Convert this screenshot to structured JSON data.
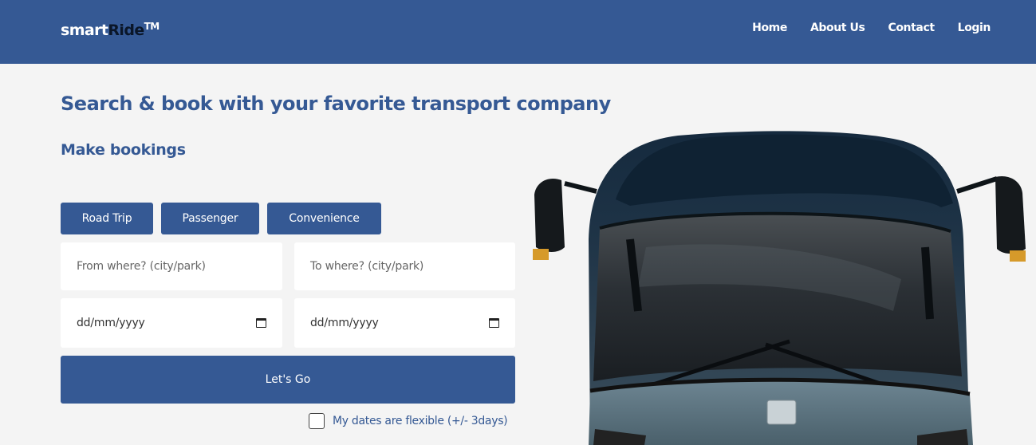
{
  "brand": {
    "part1": "smart",
    "part2": "Ride",
    "tm": "TM"
  },
  "nav": [
    "Home",
    "About Us",
    "Contact",
    "Login"
  ],
  "headline": "Search & book with your favorite transport company",
  "subhead": "Make bookings",
  "tabs": [
    "Road Trip",
    "Passenger",
    "Convenience"
  ],
  "form": {
    "from_placeholder": "From where? (city/park)",
    "to_placeholder": "To where? (city/park)",
    "date1_placeholder": "dd/mm/yyyy",
    "date2_placeholder": "dd/mm/yyyy",
    "submit_label": "Let's Go",
    "flexible_label": "My dates are flexible (+/- 3days)",
    "flexible_checked": false
  },
  "colors": {
    "primary": "#355994",
    "background": "#f4f4f4",
    "brand_dark": "#0a1628"
  },
  "hero_image": "bus-front-image"
}
